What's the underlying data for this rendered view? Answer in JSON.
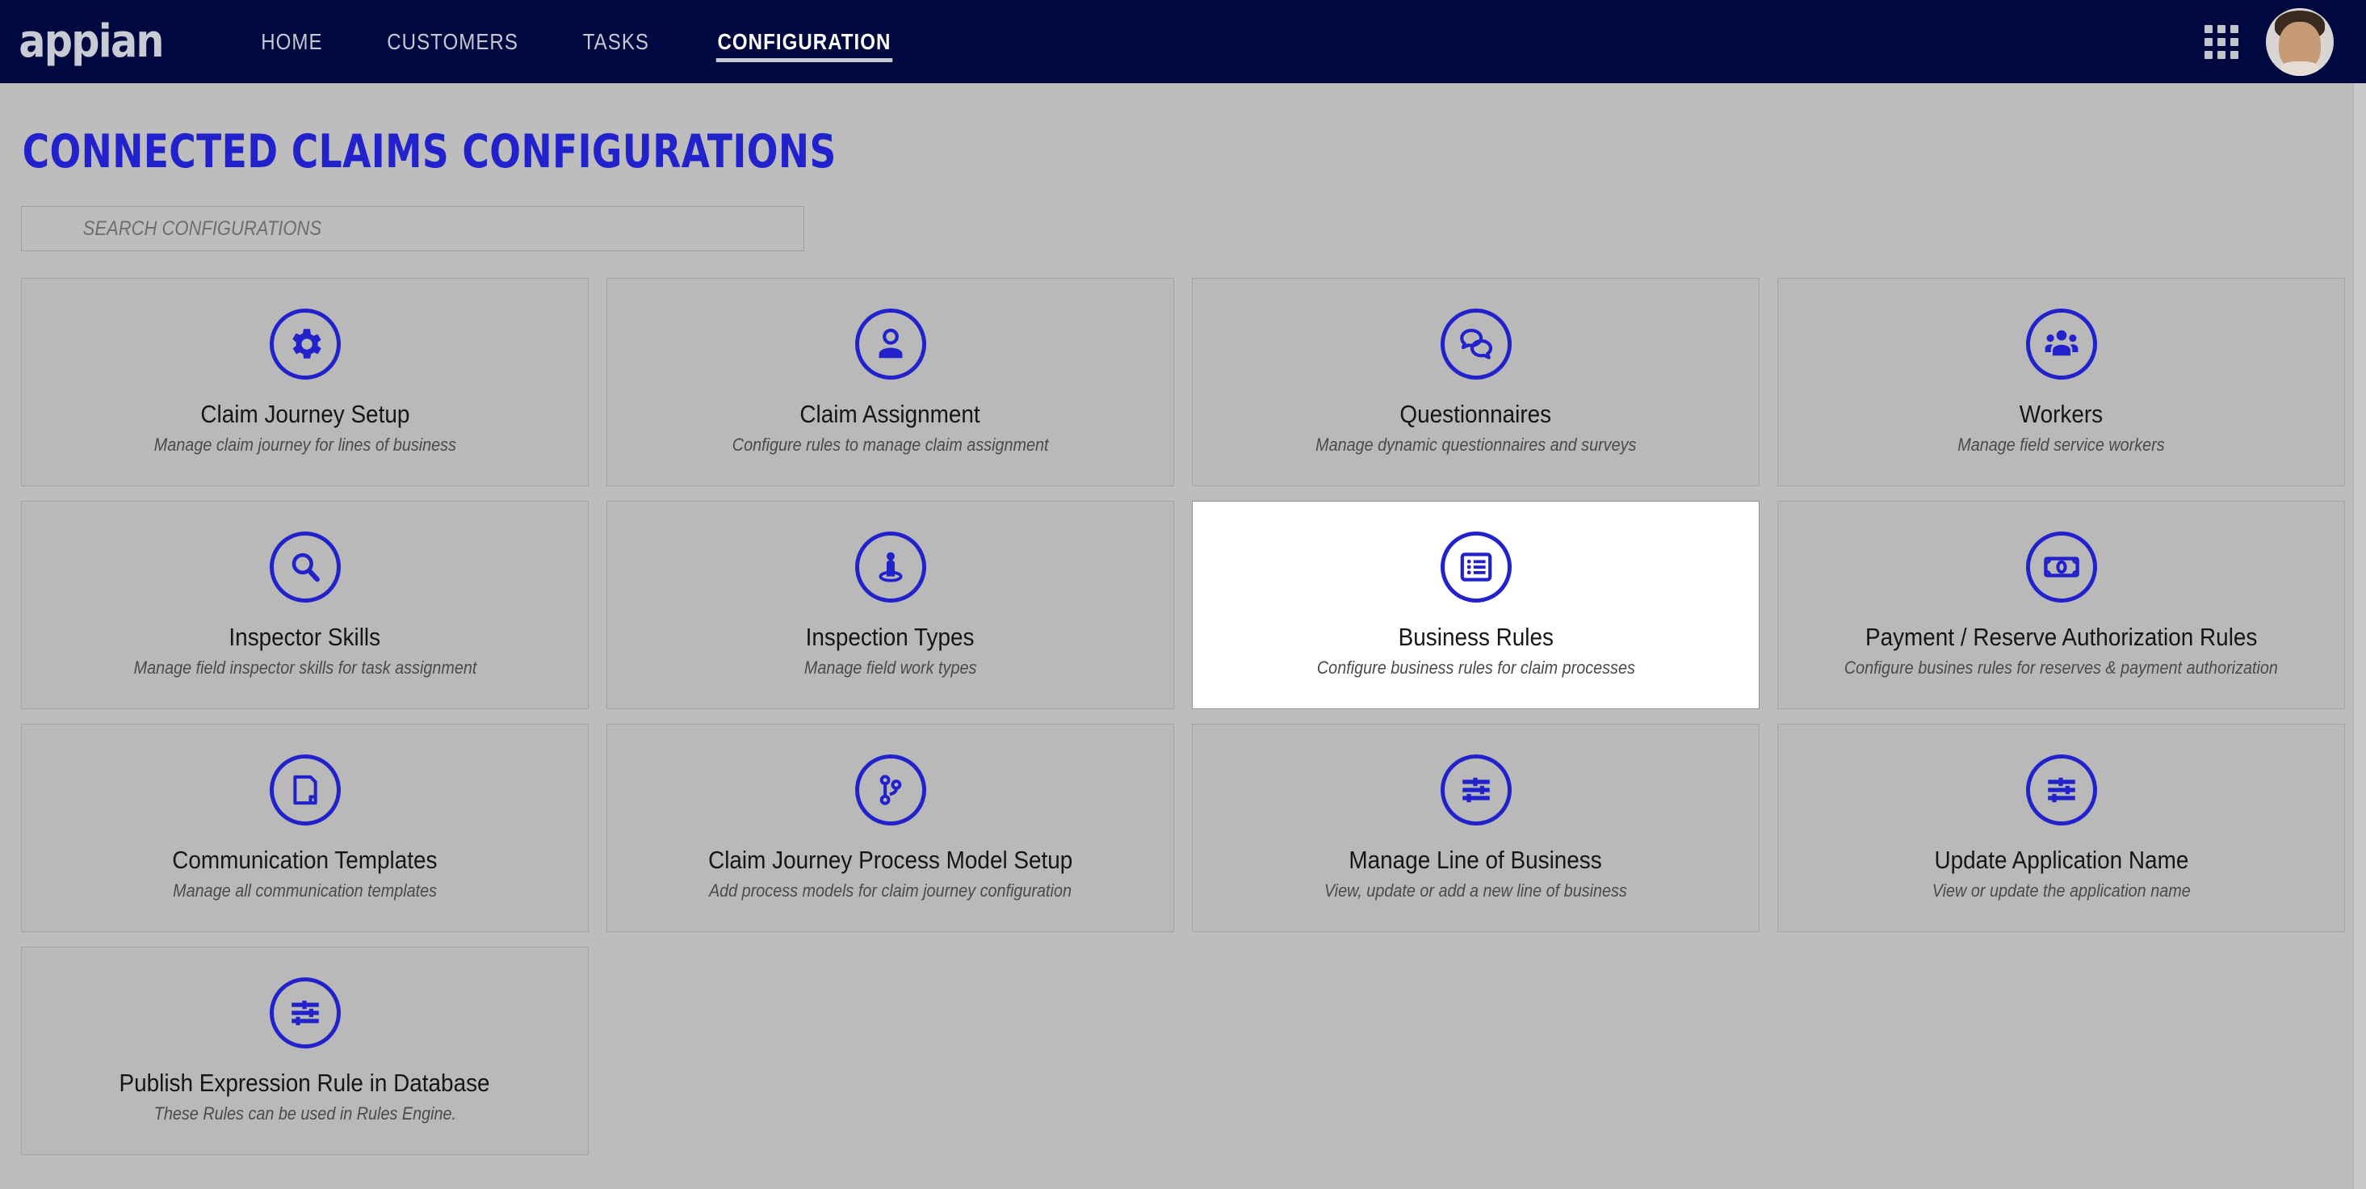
{
  "navbar": {
    "logo": "appian",
    "links": [
      {
        "label": "HOME",
        "active": false
      },
      {
        "label": "CUSTOMERS",
        "active": false
      },
      {
        "label": "TASKS",
        "active": false
      },
      {
        "label": "CONFIGURATION",
        "active": true
      }
    ],
    "apps_icon": "grid-apps-icon",
    "avatar_icon": "user-avatar"
  },
  "header": {
    "title": "CONNECTED CLAIMS CONFIGURATIONS",
    "title_color": "#2222cc"
  },
  "search": {
    "placeholder": "SEARCH CONFIGURATIONS",
    "value": ""
  },
  "theme": {
    "nav_background": "#000840",
    "page_background": "#bdbdbd",
    "card_background": "#b9b9b9",
    "card_hover_background": "#ffffff",
    "accent": "#2222cc"
  },
  "cards": [
    {
      "title": "Claim Journey Setup",
      "description": "Manage claim journey for lines of business",
      "icon": "gear-icon",
      "hovered": false
    },
    {
      "title": "Claim Assignment",
      "description": "Configure rules to manage claim assignment",
      "icon": "person-icon",
      "hovered": false
    },
    {
      "title": "Questionnaires",
      "description": "Manage dynamic questionnaires and surveys",
      "icon": "chat-bubbles-icon",
      "hovered": false
    },
    {
      "title": "Workers",
      "description": "Manage field service workers",
      "icon": "people-group-icon",
      "hovered": false
    },
    {
      "title": "Inspector Skills",
      "description": "Manage field inspector skills for task assignment",
      "icon": "magnifier-icon",
      "hovered": false
    },
    {
      "title": "Inspection Types",
      "description": "Manage field work types",
      "icon": "person-on-platform-icon",
      "hovered": false
    },
    {
      "title": "Business Rules",
      "description": "Configure business rules for claim processes",
      "icon": "list-icon",
      "hovered": true
    },
    {
      "title": "Payment / Reserve Authorization Rules",
      "description": "Configure busines rules for reserves & payment authorization",
      "icon": "banknote-icon",
      "hovered": false
    },
    {
      "title": "Communication Templates",
      "description": "Manage all communication templates",
      "icon": "document-icon",
      "hovered": false
    },
    {
      "title": "Claim Journey Process Model Setup",
      "description": "Add process models for claim journey configuration",
      "icon": "branch-icon",
      "hovered": false
    },
    {
      "title": "Manage Line of Business",
      "description": "View, update or add a new line of business",
      "icon": "sliders-icon",
      "hovered": false
    },
    {
      "title": "Update Application Name",
      "description": "View or update the application name",
      "icon": "sliders-icon",
      "hovered": false
    },
    {
      "title": "Publish Expression Rule in Database",
      "description": "These Rules can be used in Rules Engine.",
      "icon": "sliders-icon",
      "hovered": false
    }
  ]
}
